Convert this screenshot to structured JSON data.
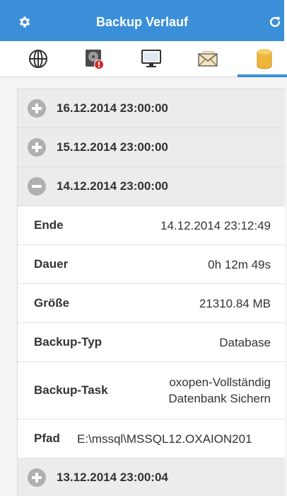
{
  "header": {
    "title": "Backup Verlauf",
    "left_icon": "gear-icon",
    "right_icon": "refresh-icon"
  },
  "tabs": [
    {
      "icon": "globe-icon",
      "active": false
    },
    {
      "icon": "harddisk-alert-icon",
      "active": false
    },
    {
      "icon": "monitor-icon",
      "active": false
    },
    {
      "icon": "mail-icon",
      "active": false
    },
    {
      "icon": "database-icon",
      "active": true
    }
  ],
  "entries": [
    {
      "date": "16.12.2014 23:00:00",
      "expanded": false
    },
    {
      "date": "15.12.2014 23:00:00",
      "expanded": false
    },
    {
      "date": "14.12.2014 23:00:00",
      "expanded": true
    },
    {
      "date": "13.12.2014 23:00:04",
      "expanded": false
    }
  ],
  "details": {
    "ende_label": "Ende",
    "ende_value": "14.12.2014 23:12:49",
    "dauer_label": "Dauer",
    "dauer_value": "0h 12m 49s",
    "groesse_label": "Größe",
    "groesse_value": "21310.84 MB",
    "typ_label": "Backup-Typ",
    "typ_value": "Database",
    "task_label": "Backup-Task",
    "task_value_line1": "oxopen-Vollständig",
    "task_value_line2": "Datenbank Sichern",
    "pfad_label": "Pfad",
    "pfad_value": "E:\\mssql\\MSSQL12.OXAION201"
  },
  "colors": {
    "accent": "#3a8fd8",
    "row_bg": "#ececec",
    "icon_gray": "#b0b0b0",
    "db_yellow": "#f0b43a"
  }
}
